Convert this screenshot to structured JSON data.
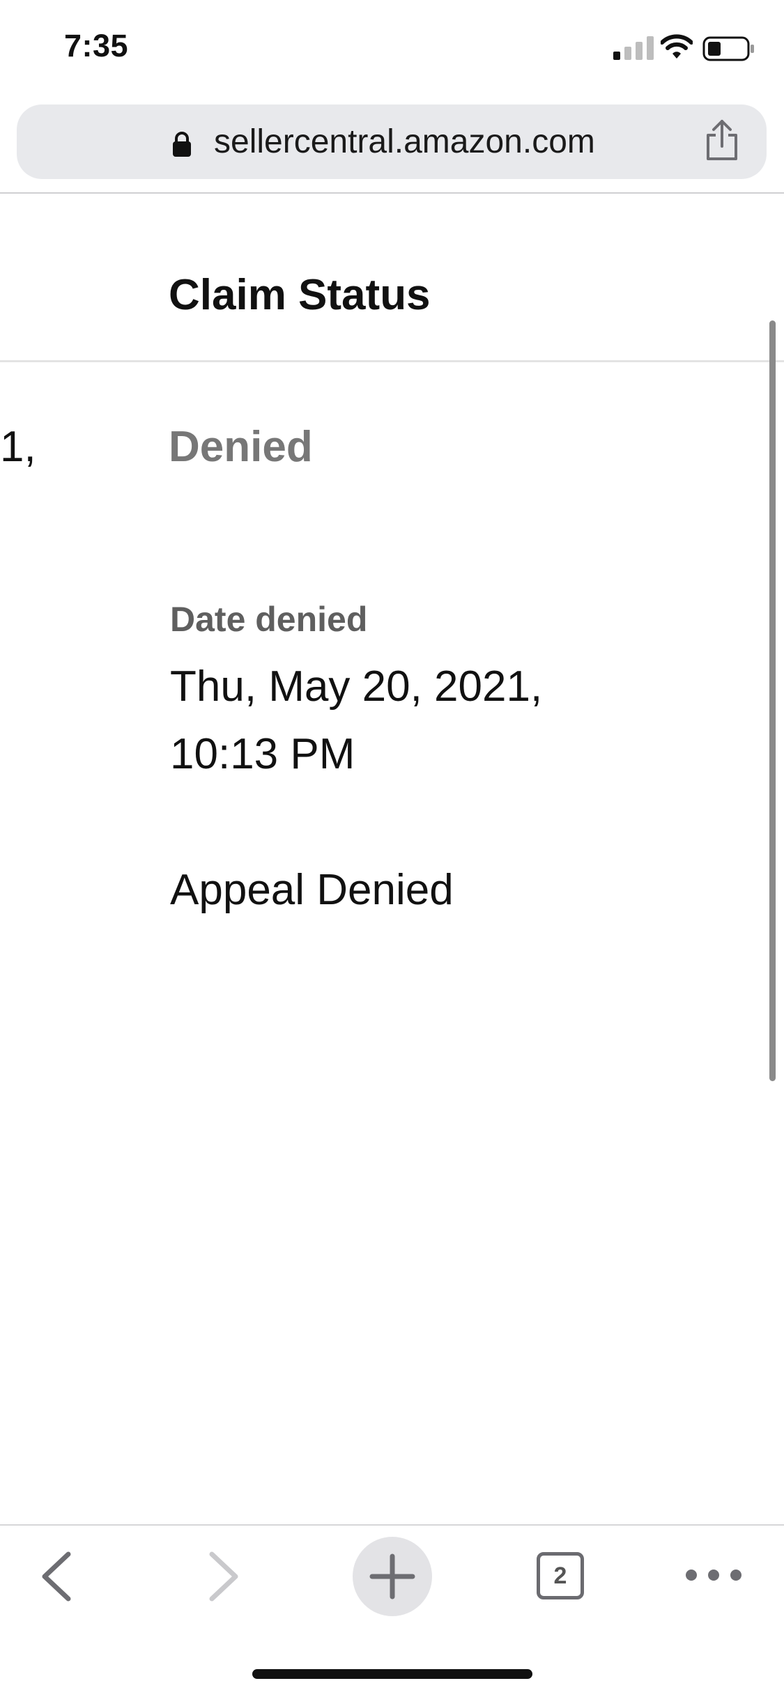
{
  "status_bar": {
    "time": "7:35",
    "icons": [
      "signal-icon",
      "wifi-icon",
      "battery-icon"
    ]
  },
  "browser": {
    "url": "sellercentral.amazon.com",
    "icons": [
      "lock-icon",
      "share-icon"
    ],
    "open_tabs_count": "2",
    "toolbar_icons": [
      "back-icon",
      "forward-icon",
      "plus-icon",
      "tabs-icon",
      "more-icon"
    ]
  },
  "page": {
    "column_title": "Claim Status",
    "left_column_fragment": "1,",
    "status": "Denied",
    "date_label": "Date denied",
    "date_line1": "Thu, May 20, 2021,",
    "date_line2": "10:13 PM",
    "note": "Appeal Denied"
  },
  "colors": {
    "status_gray": "#777777",
    "label_gray": "#5f5f5f",
    "url_bar_bg": "#e8e9ec"
  }
}
